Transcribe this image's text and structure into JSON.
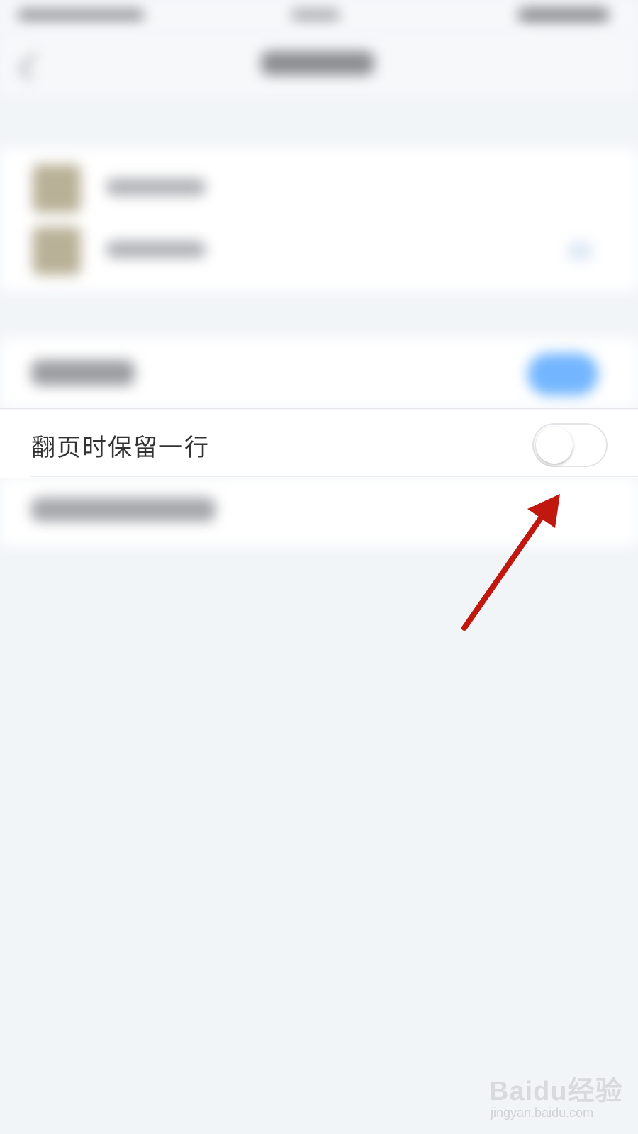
{
  "setting_row": {
    "label": "翻页时保留一行",
    "toggle_on": false
  },
  "colors": {
    "background": "#f2f5f8",
    "row_background": "#ffffff",
    "label_text": "#333333",
    "toggle_on_blurred": "#73b6ff",
    "arrow": "#c0170f"
  },
  "watermark": {
    "logo_text": "Baidu经验",
    "url": "jingyan.baidu.com"
  }
}
